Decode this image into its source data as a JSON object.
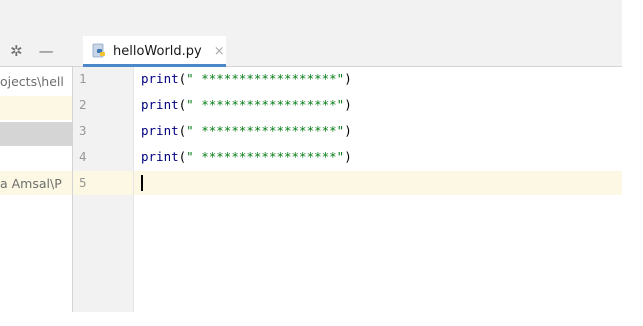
{
  "toolbar": {
    "settings_icon": "gear-icon",
    "minimize_icon": "minimize-icon"
  },
  "tabs": [
    {
      "label": "helloWorld.py",
      "icon": "python-file-icon",
      "close": "×",
      "active": true
    }
  ],
  "project_panel": {
    "rows": [
      {
        "text": "ojects\\hell"
      },
      {
        "text": "a Amsal\\P"
      }
    ]
  },
  "editor": {
    "lines": [
      {
        "num": "1",
        "kw": "print",
        "open": "(",
        "str": "\" ******************\"",
        "close": ")"
      },
      {
        "num": "2",
        "kw": "print",
        "open": "(",
        "str": "\" ******************\"",
        "close": ")"
      },
      {
        "num": "3",
        "kw": "print",
        "open": "(",
        "str": "\" ******************\"",
        "close": ")"
      },
      {
        "num": "4",
        "kw": "print",
        "open": "(",
        "str": "\" ******************\"",
        "close": ")"
      },
      {
        "num": "5",
        "kw": "",
        "open": "",
        "str": "",
        "close": ""
      }
    ]
  }
}
